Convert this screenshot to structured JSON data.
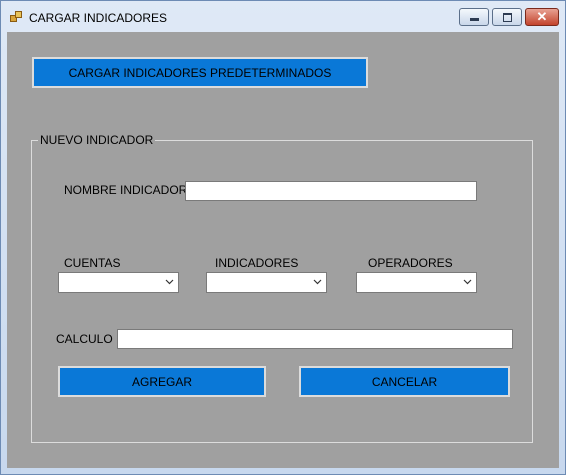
{
  "window": {
    "title": "CARGAR INDICADORES"
  },
  "buttons": {
    "load_defaults": "CARGAR INDICADORES PREDETERMINADOS",
    "add": "AGREGAR",
    "cancel": "CANCELAR"
  },
  "group": {
    "legend": "NUEVO INDICADOR",
    "nombre_label": "NOMBRE INDICADOR",
    "nombre_value": "",
    "cuentas_label": "CUENTAS",
    "cuentas_value": "",
    "indicadores_label": "INDICADORES",
    "indicadores_value": "",
    "operadores_label": "OPERADORES",
    "operadores_value": "",
    "calculo_label": "CALCULO",
    "calculo_value": ""
  },
  "colors": {
    "client_background": "#a0a0a0",
    "button_blue": "#0a78d7",
    "close_red": "#c3432c"
  },
  "icons": {
    "app": "app-form-icon",
    "minimize": "minimize-icon",
    "maximize": "maximize-icon",
    "close": "close-icon",
    "dropdown": "chevron-down-icon"
  }
}
